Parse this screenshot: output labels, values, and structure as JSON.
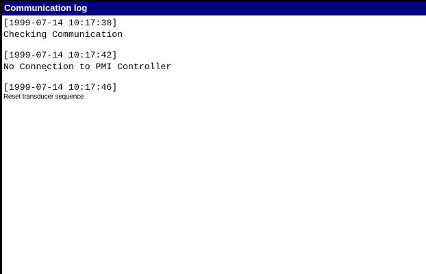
{
  "window": {
    "title": "Communication log"
  },
  "log": {
    "entries": [
      {
        "timestamp": "[1999-07-14 10:17:38]",
        "message": "Checking Communication"
      },
      {
        "timestamp": "[1999-07-14 10:17:42]",
        "message": "No Connection to PMI Controller"
      },
      {
        "timestamp": "[1999-07-14 10:17:46]",
        "message": "Reset transducer sequence"
      }
    ]
  },
  "colors": {
    "titlebar_bg": "#000080",
    "titlebar_text": "#ffffff",
    "log_bg": "#ffffff",
    "log_text": "#000000"
  }
}
